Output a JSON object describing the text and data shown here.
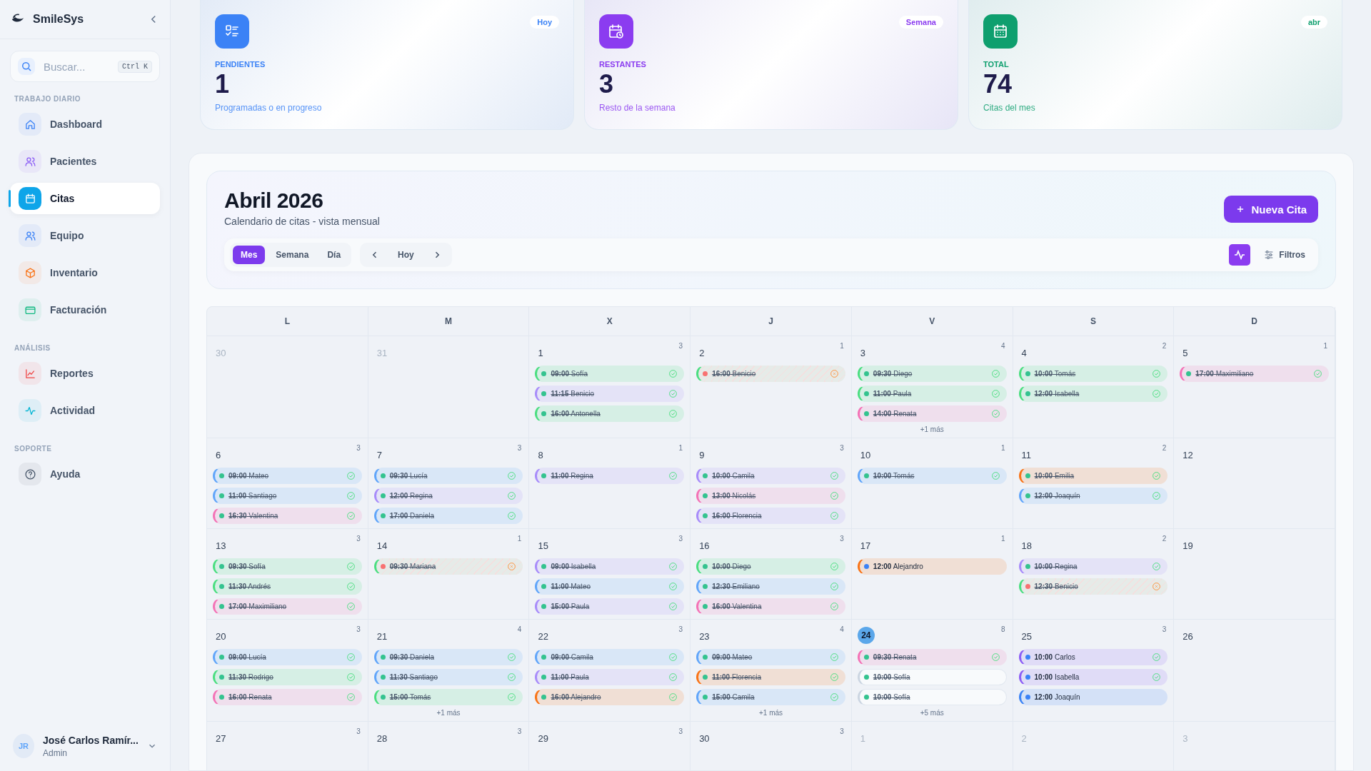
{
  "sidebar": {
    "brand": "SmileSys",
    "search": {
      "placeholder": "Buscar...",
      "shortcut": "Ctrl K"
    },
    "sections": [
      {
        "title": "TRABAJO DIARIO",
        "items": [
          {
            "label": "Dashboard",
            "selected": false
          },
          {
            "label": "Pacientes",
            "selected": false
          },
          {
            "label": "Citas",
            "selected": true
          },
          {
            "label": "Equipo",
            "selected": false
          },
          {
            "label": "Inventario",
            "selected": false
          },
          {
            "label": "Facturación",
            "selected": false
          }
        ]
      },
      {
        "title": "ANÁLISIS",
        "items": [
          {
            "label": "Reportes",
            "selected": false
          },
          {
            "label": "Actividad",
            "selected": false
          }
        ]
      },
      {
        "title": "SOPORTE",
        "items": [
          {
            "label": "Ayuda",
            "selected": false
          }
        ]
      }
    ],
    "user": {
      "initials": "JR",
      "name": "José Carlos Ramír...",
      "role": "Admin"
    }
  },
  "stats": [
    {
      "badge": "Hoy",
      "label": "PENDIENTES",
      "value": "1",
      "caption": "Programadas o en progreso",
      "color": "#3b82f6"
    },
    {
      "badge": "Semana",
      "label": "RESTANTES",
      "value": "3",
      "caption": "Resto de la semana",
      "color": "#8b3cf0"
    },
    {
      "badge": "abr",
      "label": "TOTAL",
      "value": "74",
      "caption": "Citas del mes",
      "color": "#0e9f6e"
    }
  ],
  "calendar": {
    "title": "Abril 2026",
    "subtitle": "Calendario de citas - vista mensual",
    "new_button": "Nueva Cita",
    "views": [
      {
        "label": "Mes",
        "selected": true
      },
      {
        "label": "Semana",
        "selected": false
      },
      {
        "label": "Día",
        "selected": false
      }
    ],
    "today_button": "Hoy",
    "filters_button": "Filtros",
    "weekdays": [
      "L",
      "M",
      "X",
      "J",
      "V",
      "S",
      "D"
    ],
    "weeks": [
      [
        {
          "day": "30",
          "muted": true,
          "today": false
        },
        {
          "day": "31",
          "muted": true,
          "today": false
        },
        {
          "day": "1",
          "muted": false,
          "today": false,
          "count": "3",
          "events": [
            {
              "time": "09:00",
              "name": "Sofía",
              "kind": "completed",
              "color": "#4ade80"
            },
            {
              "time": "11:15",
              "name": "Benicio",
              "kind": "completed",
              "color": "#a78bfa"
            },
            {
              "time": "16:00",
              "name": "Antonella",
              "kind": "completed",
              "color": "#4ade80"
            }
          ]
        },
        {
          "day": "2",
          "muted": false,
          "today": false,
          "count": "1",
          "events": [
            {
              "time": "16:00",
              "name": "Benicio",
              "kind": "cancelled",
              "color": "#4ade80"
            }
          ]
        },
        {
          "day": "3",
          "muted": false,
          "today": false,
          "count": "4",
          "more": "+1 más",
          "events": [
            {
              "time": "09:30",
              "name": "Diego",
              "kind": "completed",
              "color": "#4ade80"
            },
            {
              "time": "11:00",
              "name": "Paula",
              "kind": "completed",
              "color": "#4ade80"
            },
            {
              "time": "14:00",
              "name": "Renata",
              "kind": "completed",
              "color": "#f472b6"
            }
          ]
        },
        {
          "day": "4",
          "muted": false,
          "today": false,
          "count": "2",
          "events": [
            {
              "time": "10:00",
              "name": "Tomás",
              "kind": "completed",
              "color": "#4ade80"
            },
            {
              "time": "12:00",
              "name": "Isabella",
              "kind": "completed",
              "color": "#4ade80"
            }
          ]
        },
        {
          "day": "5",
          "muted": false,
          "today": false,
          "count": "1",
          "events": [
            {
              "time": "17:00",
              "name": "Maximiliano",
              "kind": "completed",
              "color": "#f472b6"
            }
          ]
        }
      ],
      [
        {
          "day": "6",
          "muted": false,
          "today": false,
          "count": "3",
          "events": [
            {
              "time": "09:00",
              "name": "Mateo",
              "kind": "completed",
              "color": "#60a5fa"
            },
            {
              "time": "11:00",
              "name": "Santiago",
              "kind": "completed",
              "color": "#60a5fa"
            },
            {
              "time": "16:30",
              "name": "Valentina",
              "kind": "completed",
              "color": "#f472b6"
            }
          ]
        },
        {
          "day": "7",
          "muted": false,
          "today": false,
          "count": "3",
          "events": [
            {
              "time": "09:30",
              "name": "Lucía",
              "kind": "completed",
              "color": "#60a5fa"
            },
            {
              "time": "12:00",
              "name": "Regina",
              "kind": "completed",
              "color": "#a78bfa"
            },
            {
              "time": "17:00",
              "name": "Daniela",
              "kind": "completed",
              "color": "#60a5fa"
            }
          ]
        },
        {
          "day": "8",
          "muted": false,
          "today": false,
          "count": "1",
          "events": [
            {
              "time": "11:00",
              "name": "Regina",
              "kind": "completed",
              "color": "#a78bfa"
            }
          ]
        },
        {
          "day": "9",
          "muted": false,
          "today": false,
          "count": "3",
          "events": [
            {
              "time": "10:00",
              "name": "Camila",
              "kind": "completed",
              "color": "#a78bfa"
            },
            {
              "time": "13:00",
              "name": "Nicolás",
              "kind": "completed",
              "color": "#f472b6"
            },
            {
              "time": "16:00",
              "name": "Florencia",
              "kind": "completed",
              "color": "#a78bfa"
            }
          ]
        },
        {
          "day": "10",
          "muted": false,
          "today": false,
          "count": "1",
          "events": [
            {
              "time": "10:00",
              "name": "Tomás",
              "kind": "completed",
              "color": "#60a5fa"
            }
          ]
        },
        {
          "day": "11",
          "muted": false,
          "today": false,
          "count": "2",
          "events": [
            {
              "time": "10:00",
              "name": "Emilia",
              "kind": "completed",
              "color": "#f97316"
            },
            {
              "time": "12:00",
              "name": "Joaquín",
              "kind": "completed",
              "color": "#60a5fa"
            }
          ]
        },
        {
          "day": "12",
          "muted": false,
          "today": false
        }
      ],
      [
        {
          "day": "13",
          "muted": false,
          "today": false,
          "count": "3",
          "events": [
            {
              "time": "09:30",
              "name": "Sofía",
              "kind": "completed",
              "color": "#4ade80"
            },
            {
              "time": "11:30",
              "name": "Andrés",
              "kind": "completed",
              "color": "#4ade80"
            },
            {
              "time": "17:00",
              "name": "Maximiliano",
              "kind": "completed",
              "color": "#f472b6"
            }
          ]
        },
        {
          "day": "14",
          "muted": false,
          "today": false,
          "count": "1",
          "events": [
            {
              "time": "09:30",
              "name": "Mariana",
              "kind": "cancelled",
              "color": "#4ade80"
            }
          ]
        },
        {
          "day": "15",
          "muted": false,
          "today": false,
          "count": "3",
          "events": [
            {
              "time": "09:00",
              "name": "Isabella",
              "kind": "completed",
              "color": "#a78bfa"
            },
            {
              "time": "11:00",
              "name": "Mateo",
              "kind": "completed",
              "color": "#60a5fa"
            },
            {
              "time": "15:00",
              "name": "Paula",
              "kind": "completed",
              "color": "#a78bfa"
            }
          ]
        },
        {
          "day": "16",
          "muted": false,
          "today": false,
          "count": "3",
          "events": [
            {
              "time": "10:00",
              "name": "Diego",
              "kind": "completed",
              "color": "#4ade80"
            },
            {
              "time": "12:30",
              "name": "Emiliano",
              "kind": "completed",
              "color": "#60a5fa"
            },
            {
              "time": "16:00",
              "name": "Valentina",
              "kind": "completed",
              "color": "#f472b6"
            }
          ]
        },
        {
          "day": "17",
          "muted": false,
          "today": false,
          "count": "1",
          "events": [
            {
              "time": "12:00",
              "name": "Alejandro",
              "kind": "scheduled",
              "color": "#f97316"
            }
          ]
        },
        {
          "day": "18",
          "muted": false,
          "today": false,
          "count": "2",
          "events": [
            {
              "time": "10:00",
              "name": "Regina",
              "kind": "completed",
              "color": "#a78bfa"
            },
            {
              "time": "12:30",
              "name": "Benicio",
              "kind": "cancelled",
              "color": "#4ade80"
            }
          ]
        },
        {
          "day": "19",
          "muted": false,
          "today": false
        }
      ],
      [
        {
          "day": "20",
          "muted": false,
          "today": false,
          "count": "3",
          "events": [
            {
              "time": "09:00",
              "name": "Lucía",
              "kind": "completed",
              "color": "#60a5fa"
            },
            {
              "time": "11:30",
              "name": "Rodrigo",
              "kind": "completed",
              "color": "#4ade80"
            },
            {
              "time": "16:00",
              "name": "Renata",
              "kind": "completed",
              "color": "#f472b6"
            }
          ]
        },
        {
          "day": "21",
          "muted": false,
          "today": false,
          "count": "4",
          "more": "+1 más",
          "events": [
            {
              "time": "09:30",
              "name": "Daniela",
              "kind": "completed",
              "color": "#60a5fa"
            },
            {
              "time": "11:30",
              "name": "Santiago",
              "kind": "completed",
              "color": "#60a5fa"
            },
            {
              "time": "15:00",
              "name": "Tomás",
              "kind": "completed",
              "color": "#4ade80"
            }
          ]
        },
        {
          "day": "22",
          "muted": false,
          "today": false,
          "count": "3",
          "events": [
            {
              "time": "09:00",
              "name": "Camila",
              "kind": "completed",
              "color": "#60a5fa"
            },
            {
              "time": "11:00",
              "name": "Paula",
              "kind": "completed",
              "color": "#a78bfa"
            },
            {
              "time": "16:00",
              "name": "Alejandro",
              "kind": "completed",
              "color": "#f97316"
            }
          ]
        },
        {
          "day": "23",
          "muted": false,
          "today": false,
          "count": "4",
          "more": "+1 más",
          "events": [
            {
              "time": "09:00",
              "name": "Mateo",
              "kind": "completed",
              "color": "#60a5fa"
            },
            {
              "time": "11:00",
              "name": "Florencia",
              "kind": "completed",
              "color": "#f97316"
            },
            {
              "time": "15:00",
              "name": "Camila",
              "kind": "completed",
              "color": "#60a5fa"
            }
          ]
        },
        {
          "day": "24",
          "muted": false,
          "today": true,
          "count": "8",
          "more": "+5 más",
          "events": [
            {
              "time": "09:30",
              "name": "Renata",
              "kind": "completed",
              "color": "#f472b6"
            },
            {
              "time": "10:00",
              "name": "Sofía",
              "kind": "attended"
            },
            {
              "time": "10:00",
              "name": "Sofía",
              "kind": "attended"
            }
          ]
        },
        {
          "day": "25",
          "muted": false,
          "today": false,
          "count": "3",
          "events": [
            {
              "time": "10:00",
              "name": "Carlos",
              "kind": "confirmed",
              "color": "#8b5cf6"
            },
            {
              "time": "10:00",
              "name": "Isabella",
              "kind": "confirmed",
              "color": "#8b5cf6"
            },
            {
              "time": "12:00",
              "name": "Joaquín",
              "kind": "scheduled",
              "color": "#3b82f6"
            }
          ]
        },
        {
          "day": "26",
          "muted": false,
          "today": false
        }
      ],
      [
        {
          "day": "27",
          "muted": false,
          "today": false,
          "count": "3"
        },
        {
          "day": "28",
          "muted": false,
          "today": false,
          "count": "3"
        },
        {
          "day": "29",
          "muted": false,
          "today": false,
          "count": "3"
        },
        {
          "day": "30",
          "muted": false,
          "today": false,
          "count": "3"
        },
        {
          "day": "1",
          "muted": true,
          "today": false
        },
        {
          "day": "2",
          "muted": true,
          "today": false
        },
        {
          "day": "3",
          "muted": true,
          "today": false
        }
      ]
    ]
  }
}
